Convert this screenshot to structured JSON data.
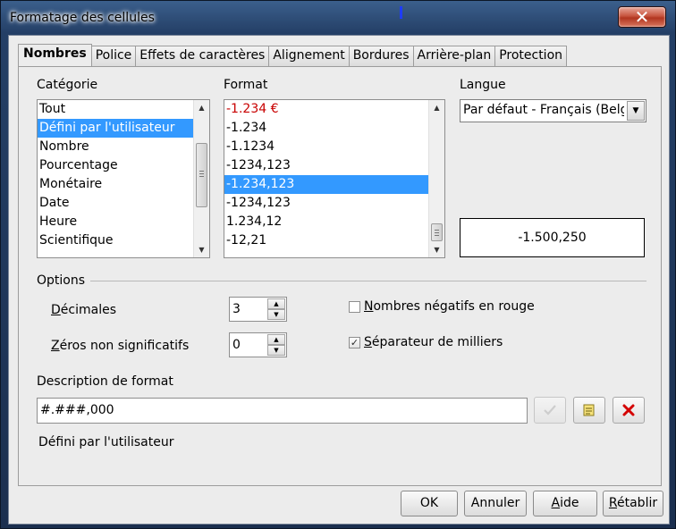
{
  "window": {
    "title": "Formatage des cellules",
    "close_glyph": "✕"
  },
  "tabs": [
    "Nombres",
    "Police",
    "Effets de caractères",
    "Alignement",
    "Bordures",
    "Arrière-plan",
    "Protection"
  ],
  "category": {
    "label": "Catégorie",
    "items": [
      "Tout",
      "Défini par l'utilisateur",
      "Nombre",
      "Pourcentage",
      "Monétaire",
      "Date",
      "Heure",
      "Scientifique"
    ],
    "selected": 1
  },
  "format": {
    "label": "Format",
    "items": [
      "-1.234 €",
      "-1.234",
      "-1.1234",
      "-1234,123",
      "-1.234,123",
      "-1234,123",
      "1.234,12",
      "-12,21"
    ],
    "selected": 4,
    "red_item": 0
  },
  "language": {
    "label": "Langue",
    "value": "Par défaut - Français (Belgique)"
  },
  "preview": {
    "value": "-1.500,250"
  },
  "options": {
    "label": "Options",
    "decimals_label": "Décimales",
    "decimals_value": "3",
    "zeros_label": "Zéros non significatifs",
    "zeros_value": "0",
    "negative_red_label": "Nombres négatifs en rouge",
    "negative_red_checked": false,
    "thousands_sep_label": "Séparateur de milliers",
    "thousands_sep_checked": true
  },
  "format_code": {
    "label": "Description de format",
    "value": "#.###,000",
    "status": "Défini par l'utilisateur"
  },
  "buttons": {
    "ok": "OK",
    "cancel": "Annuler",
    "help": "Aide",
    "reset": "Rétablir"
  },
  "colors": {
    "selection": "#3399ff",
    "negative_red": "#c80000",
    "delete_red": "#d40000"
  },
  "icons": {
    "accept": "check-icon",
    "edit": "edit-comment-icon",
    "delete": "delete-icon"
  }
}
